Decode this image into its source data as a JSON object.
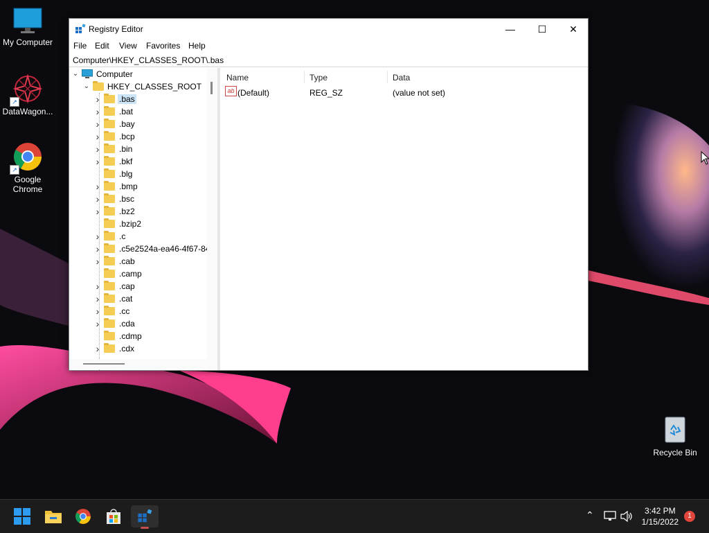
{
  "desktop": {
    "icons": [
      {
        "label": "My Computer"
      },
      {
        "label": "DataWagon..."
      },
      {
        "label": "Google Chrome"
      },
      {
        "label": "Recycle Bin"
      }
    ]
  },
  "window": {
    "title": "Registry Editor",
    "controls": {
      "minimize": "—",
      "maximize": "☐",
      "close": "✕"
    },
    "menu": [
      "File",
      "Edit",
      "View",
      "Favorites",
      "Help"
    ],
    "address": "Computer\\HKEY_CLASSES_ROOT\\.bas",
    "tree": {
      "root": "Computer",
      "hive": "HKEY_CLASSES_ROOT",
      "keys": [
        ".bas",
        ".bat",
        ".bay",
        ".bcp",
        ".bin",
        ".bkf",
        ".blg",
        ".bmp",
        ".bsc",
        ".bz2",
        ".bzip2",
        ".c",
        ".c5e2524a-ea46-4f67-84",
        ".cab",
        ".camp",
        ".cap",
        ".cat",
        ".cc",
        ".cda",
        ".cdmp",
        ".cdx"
      ],
      "selected": ".bas"
    },
    "list": {
      "columns": [
        "Name",
        "Type",
        "Data"
      ],
      "rows": [
        {
          "name": "(Default)",
          "type": "REG_SZ",
          "data": "(value not set)"
        }
      ]
    }
  },
  "taskbar": {
    "time": "3:42 PM",
    "date": "1/15/2022",
    "notification_count": "1"
  }
}
